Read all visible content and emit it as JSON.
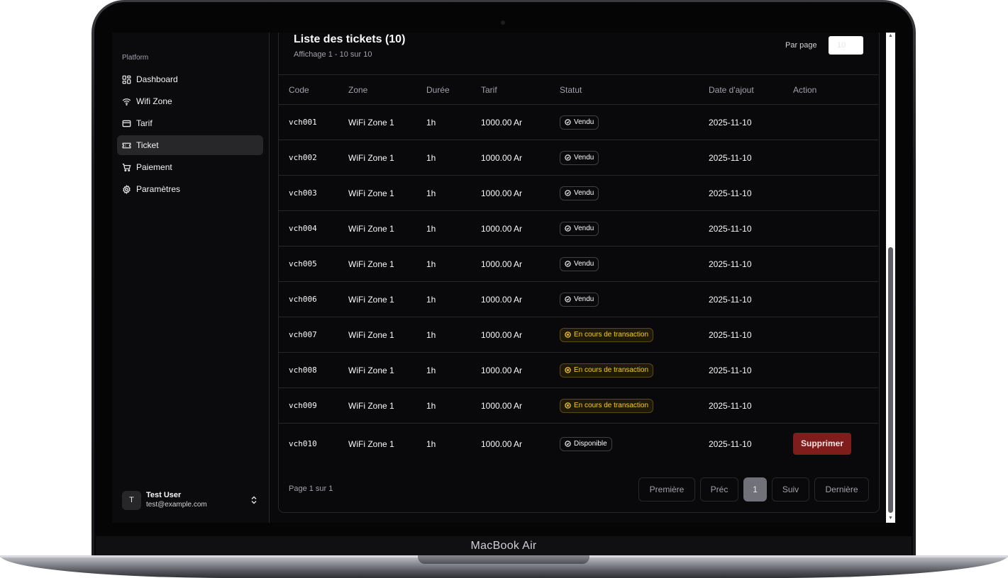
{
  "device_label": "MacBook Air",
  "sidebar": {
    "section_label": "Platform",
    "items": [
      {
        "label": "Dashboard",
        "icon": "dashboard-icon",
        "active": false
      },
      {
        "label": "Wifi Zone",
        "icon": "wifi-icon",
        "active": false
      },
      {
        "label": "Tarif",
        "icon": "card-icon",
        "active": false
      },
      {
        "label": "Ticket",
        "icon": "ticket-icon",
        "active": true
      },
      {
        "label": "Paiement",
        "icon": "cart-icon",
        "active": false
      },
      {
        "label": "Paramètres",
        "icon": "gear-icon",
        "active": false
      }
    ],
    "user": {
      "initial": "T",
      "name": "Test User",
      "email": "test@example.com"
    }
  },
  "main": {
    "title": "Liste des tickets (10)",
    "subtitle": "Affichage 1 - 10 sur 10",
    "per_page_label": "Par page",
    "per_page_value": "10",
    "table": {
      "headers": [
        "Code",
        "Zone",
        "Durée",
        "Tarif",
        "Statut",
        "Date d'ajout",
        "Action"
      ],
      "rows": [
        {
          "code": "vch001",
          "zone": "WiFi Zone 1",
          "duree": "1h",
          "tarif": "1000.00 Ar",
          "statut": "Vendu",
          "statut_type": "ok",
          "date": "2025-11-10",
          "action": ""
        },
        {
          "code": "vch002",
          "zone": "WiFi Zone 1",
          "duree": "1h",
          "tarif": "1000.00 Ar",
          "statut": "Vendu",
          "statut_type": "ok",
          "date": "2025-11-10",
          "action": ""
        },
        {
          "code": "vch003",
          "zone": "WiFi Zone 1",
          "duree": "1h",
          "tarif": "1000.00 Ar",
          "statut": "Vendu",
          "statut_type": "ok",
          "date": "2025-11-10",
          "action": ""
        },
        {
          "code": "vch004",
          "zone": "WiFi Zone 1",
          "duree": "1h",
          "tarif": "1000.00 Ar",
          "statut": "Vendu",
          "statut_type": "ok",
          "date": "2025-11-10",
          "action": ""
        },
        {
          "code": "vch005",
          "zone": "WiFi Zone 1",
          "duree": "1h",
          "tarif": "1000.00 Ar",
          "statut": "Vendu",
          "statut_type": "ok",
          "date": "2025-11-10",
          "action": ""
        },
        {
          "code": "vch006",
          "zone": "WiFi Zone 1",
          "duree": "1h",
          "tarif": "1000.00 Ar",
          "statut": "Vendu",
          "statut_type": "ok",
          "date": "2025-11-10",
          "action": ""
        },
        {
          "code": "vch007",
          "zone": "WiFi Zone 1",
          "duree": "1h",
          "tarif": "1000.00 Ar",
          "statut": "En cours de transaction",
          "statut_type": "warn",
          "date": "2025-11-10",
          "action": ""
        },
        {
          "code": "vch008",
          "zone": "WiFi Zone 1",
          "duree": "1h",
          "tarif": "1000.00 Ar",
          "statut": "En cours de transaction",
          "statut_type": "warn",
          "date": "2025-11-10",
          "action": ""
        },
        {
          "code": "vch009",
          "zone": "WiFi Zone 1",
          "duree": "1h",
          "tarif": "1000.00 Ar",
          "statut": "En cours de transaction",
          "statut_type": "warn",
          "date": "2025-11-10",
          "action": ""
        },
        {
          "code": "vch010",
          "zone": "WiFi Zone 1",
          "duree": "1h",
          "tarif": "1000.00 Ar",
          "statut": "Disponible",
          "statut_type": "ok",
          "date": "2025-11-10",
          "action": "Supprimer"
        }
      ]
    },
    "pagination": {
      "info": "Page 1 sur 1",
      "first": "Première",
      "prev": "Préc",
      "current": "1",
      "next": "Suiv",
      "last": "Dernière"
    }
  },
  "colors": {
    "background": "#09090b",
    "border": "#27272a",
    "warning": "#facc15",
    "danger": "#7f1d1d"
  }
}
